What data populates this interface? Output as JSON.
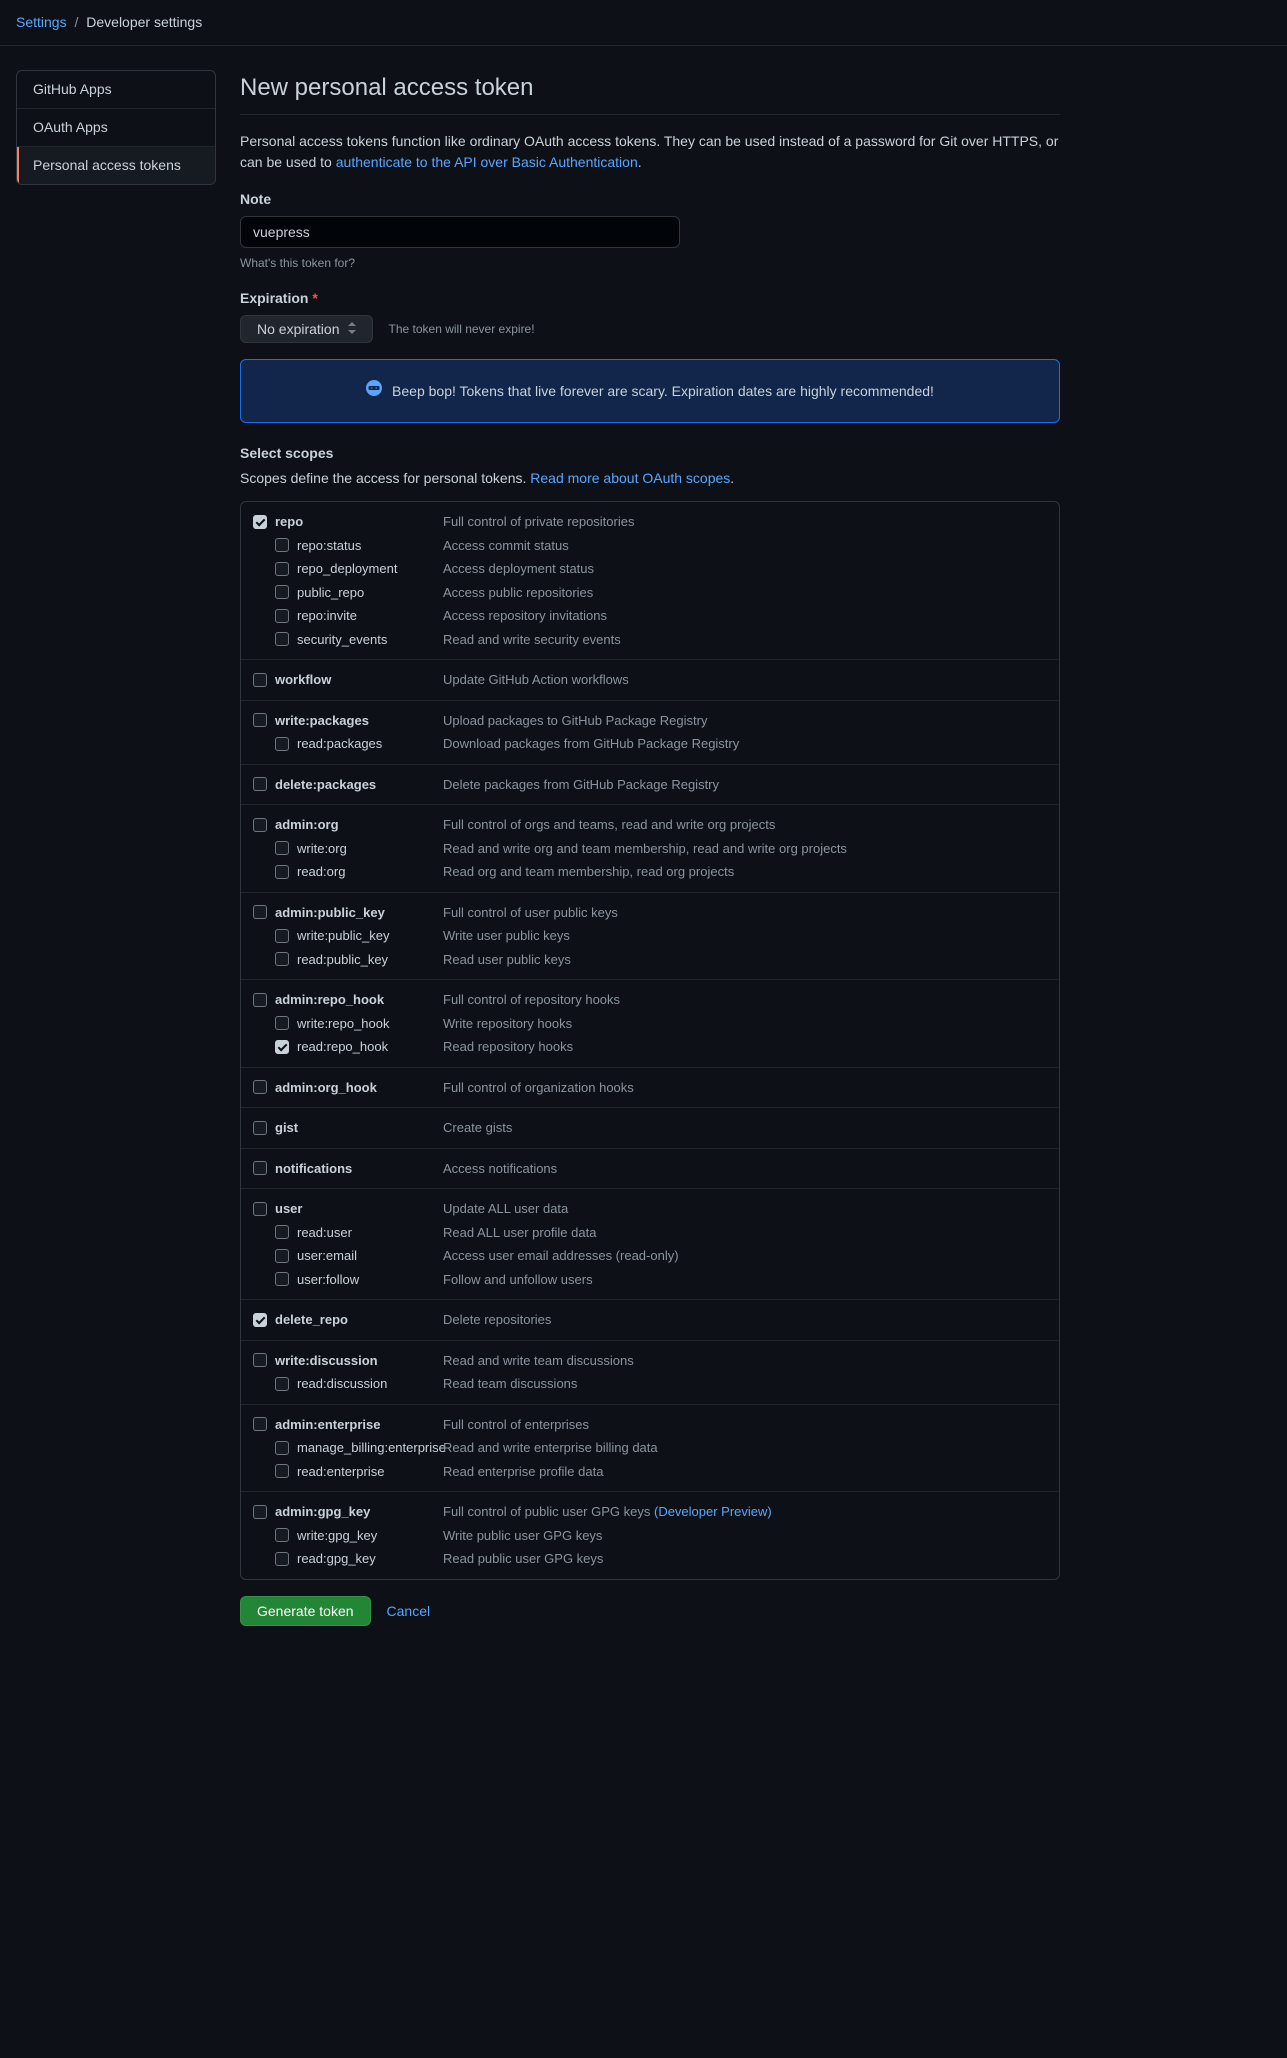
{
  "breadcrumb": {
    "root": "Settings",
    "current": "Developer settings"
  },
  "sidebar": {
    "items": [
      {
        "label": "GitHub Apps",
        "active": false
      },
      {
        "label": "OAuth Apps",
        "active": false
      },
      {
        "label": "Personal access tokens",
        "active": true
      }
    ]
  },
  "page": {
    "title": "New personal access token",
    "intro_pre": "Personal access tokens function like ordinary OAuth access tokens. They can be used instead of a password for Git over HTTPS, or can be used to ",
    "intro_link": "authenticate to the API over Basic Authentication",
    "intro_post": "."
  },
  "note": {
    "label": "Note",
    "value": "vuepress",
    "hint": "What's this token for?"
  },
  "expiration": {
    "label": "Expiration",
    "required": "*",
    "selected": "No expiration",
    "note": "The token will never expire!"
  },
  "flash": {
    "text": "Beep bop! Tokens that live forever are scary. Expiration dates are highly recommended!"
  },
  "scopes_header": {
    "title": "Select scopes",
    "sub_pre": "Scopes define the access for personal tokens. ",
    "sub_link": "Read more about OAuth scopes",
    "sub_post": "."
  },
  "scopes": [
    {
      "items": [
        {
          "name": "repo",
          "desc": "Full control of private repositories",
          "checked": true,
          "parent": true
        },
        {
          "name": "repo:status",
          "desc": "Access commit status",
          "checked": false
        },
        {
          "name": "repo_deployment",
          "desc": "Access deployment status",
          "checked": false
        },
        {
          "name": "public_repo",
          "desc": "Access public repositories",
          "checked": false
        },
        {
          "name": "repo:invite",
          "desc": "Access repository invitations",
          "checked": false
        },
        {
          "name": "security_events",
          "desc": "Read and write security events",
          "checked": false
        }
      ]
    },
    {
      "items": [
        {
          "name": "workflow",
          "desc": "Update GitHub Action workflows",
          "checked": false,
          "parent": true
        }
      ]
    },
    {
      "items": [
        {
          "name": "write:packages",
          "desc": "Upload packages to GitHub Package Registry",
          "checked": false,
          "parent": true
        },
        {
          "name": "read:packages",
          "desc": "Download packages from GitHub Package Registry",
          "checked": false
        }
      ]
    },
    {
      "items": [
        {
          "name": "delete:packages",
          "desc": "Delete packages from GitHub Package Registry",
          "checked": false,
          "parent": true
        }
      ]
    },
    {
      "items": [
        {
          "name": "admin:org",
          "desc": "Full control of orgs and teams, read and write org projects",
          "checked": false,
          "parent": true
        },
        {
          "name": "write:org",
          "desc": "Read and write org and team membership, read and write org projects",
          "checked": false
        },
        {
          "name": "read:org",
          "desc": "Read org and team membership, read org projects",
          "checked": false
        }
      ]
    },
    {
      "items": [
        {
          "name": "admin:public_key",
          "desc": "Full control of user public keys",
          "checked": false,
          "parent": true
        },
        {
          "name": "write:public_key",
          "desc": "Write user public keys",
          "checked": false
        },
        {
          "name": "read:public_key",
          "desc": "Read user public keys",
          "checked": false
        }
      ]
    },
    {
      "items": [
        {
          "name": "admin:repo_hook",
          "desc": "Full control of repository hooks",
          "checked": false,
          "parent": true
        },
        {
          "name": "write:repo_hook",
          "desc": "Write repository hooks",
          "checked": false
        },
        {
          "name": "read:repo_hook",
          "desc": "Read repository hooks",
          "checked": true
        }
      ]
    },
    {
      "items": [
        {
          "name": "admin:org_hook",
          "desc": "Full control of organization hooks",
          "checked": false,
          "parent": true
        }
      ]
    },
    {
      "items": [
        {
          "name": "gist",
          "desc": "Create gists",
          "checked": false,
          "parent": true
        }
      ]
    },
    {
      "items": [
        {
          "name": "notifications",
          "desc": "Access notifications",
          "checked": false,
          "parent": true
        }
      ]
    },
    {
      "items": [
        {
          "name": "user",
          "desc": "Update ALL user data",
          "checked": false,
          "parent": true
        },
        {
          "name": "read:user",
          "desc": "Read ALL user profile data",
          "checked": false
        },
        {
          "name": "user:email",
          "desc": "Access user email addresses (read-only)",
          "checked": false
        },
        {
          "name": "user:follow",
          "desc": "Follow and unfollow users",
          "checked": false
        }
      ]
    },
    {
      "items": [
        {
          "name": "delete_repo",
          "desc": "Delete repositories",
          "checked": true,
          "parent": true
        }
      ]
    },
    {
      "items": [
        {
          "name": "write:discussion",
          "desc": "Read and write team discussions",
          "checked": false,
          "parent": true
        },
        {
          "name": "read:discussion",
          "desc": "Read team discussions",
          "checked": false
        }
      ]
    },
    {
      "items": [
        {
          "name": "admin:enterprise",
          "desc": "Full control of enterprises",
          "checked": false,
          "parent": true
        },
        {
          "name": "manage_billing:enterprise",
          "desc": "Read and write enterprise billing data",
          "checked": false
        },
        {
          "name": "read:enterprise",
          "desc": "Read enterprise profile data",
          "checked": false
        }
      ]
    },
    {
      "items": [
        {
          "name": "admin:gpg_key",
          "desc": "Full control of public user GPG keys ",
          "desc_link": "(Developer Preview)",
          "checked": false,
          "parent": true
        },
        {
          "name": "write:gpg_key",
          "desc": "Write public user GPG keys",
          "checked": false
        },
        {
          "name": "read:gpg_key",
          "desc": "Read public user GPG keys",
          "checked": false
        }
      ]
    }
  ],
  "actions": {
    "generate": "Generate token",
    "cancel": "Cancel"
  }
}
